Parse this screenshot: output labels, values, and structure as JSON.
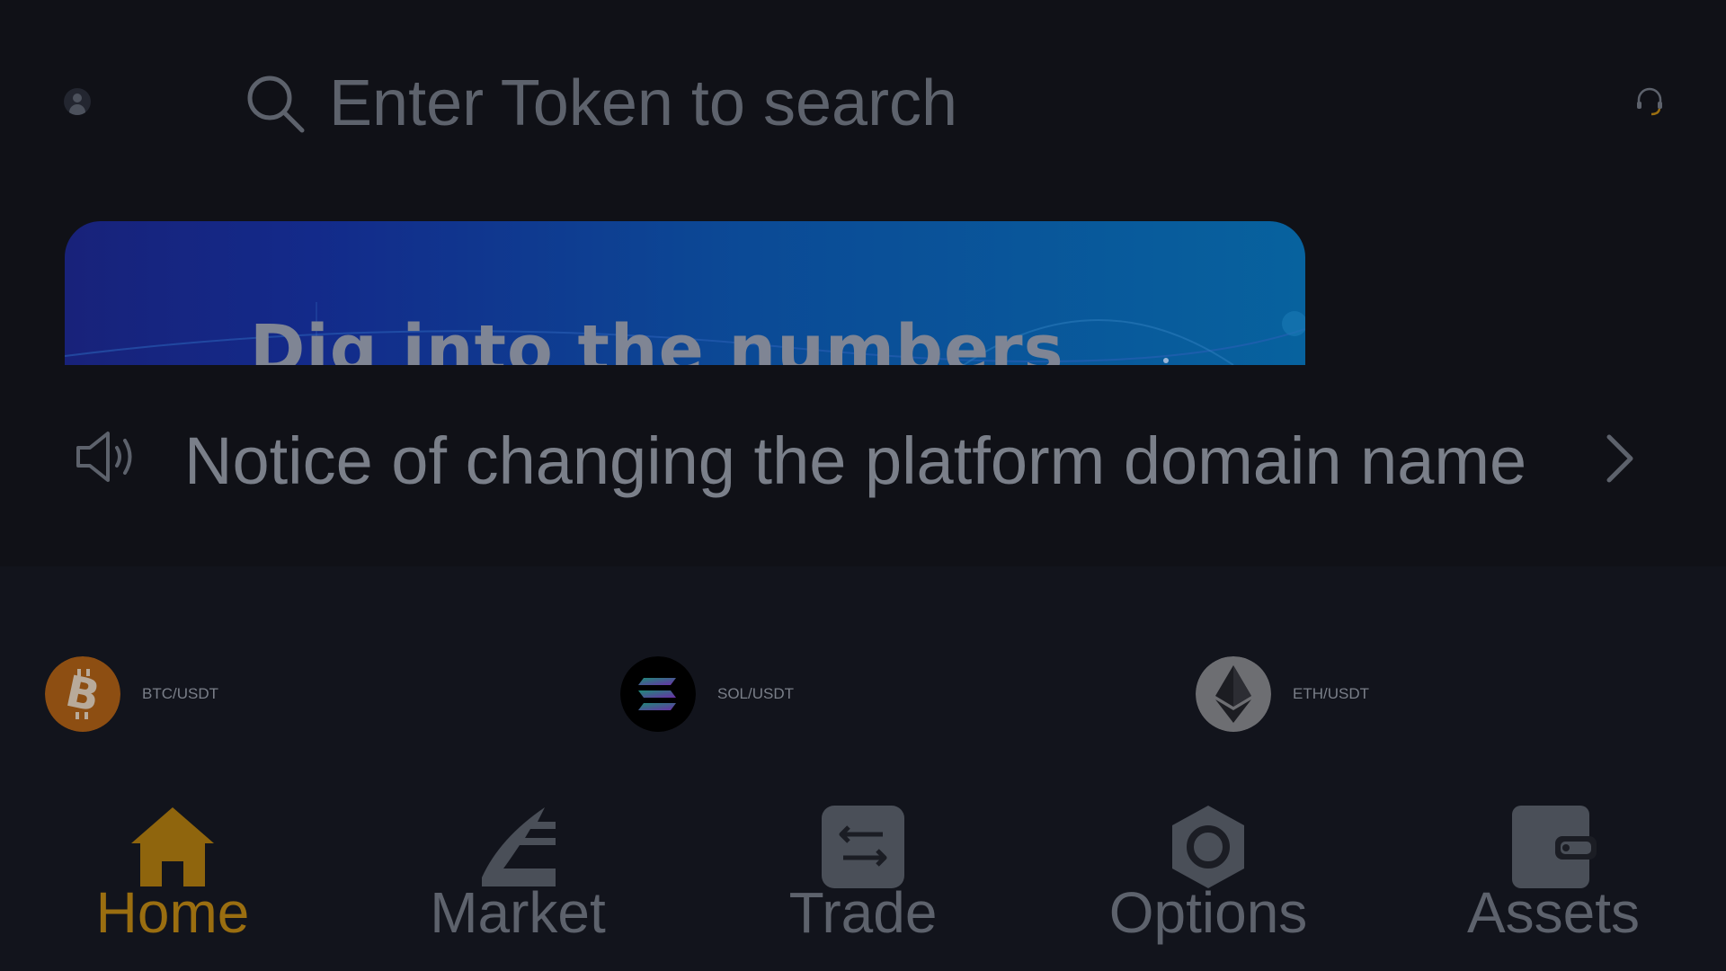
{
  "search": {
    "placeholder": "Enter Token to search"
  },
  "banner": {
    "title": "Dig into the numbers"
  },
  "notice": {
    "text": "Notice of changing the platform domain name"
  },
  "tickers": [
    {
      "pair": "BTC/USDT",
      "icon": "bitcoin-icon",
      "color": "#d8781f"
    },
    {
      "pair": "SOL/USDT",
      "icon": "solana-icon",
      "color": "#000000"
    },
    {
      "pair": "ETH/USDT",
      "icon": "ethereum-icon",
      "color": "#bfc0c4"
    }
  ],
  "nav": {
    "items": [
      {
        "label": "Home",
        "icon": "home-icon",
        "active": true
      },
      {
        "label": "Market",
        "icon": "market-icon",
        "active": false
      },
      {
        "label": "Trade",
        "icon": "trade-icon",
        "active": false
      },
      {
        "label": "Options",
        "icon": "options-icon",
        "active": false
      },
      {
        "label": "Assets",
        "icon": "wallet-icon",
        "active": false
      }
    ]
  },
  "colors": {
    "background": "#101117",
    "accent": "#9a6e10",
    "muted_text": "#5d626c"
  }
}
